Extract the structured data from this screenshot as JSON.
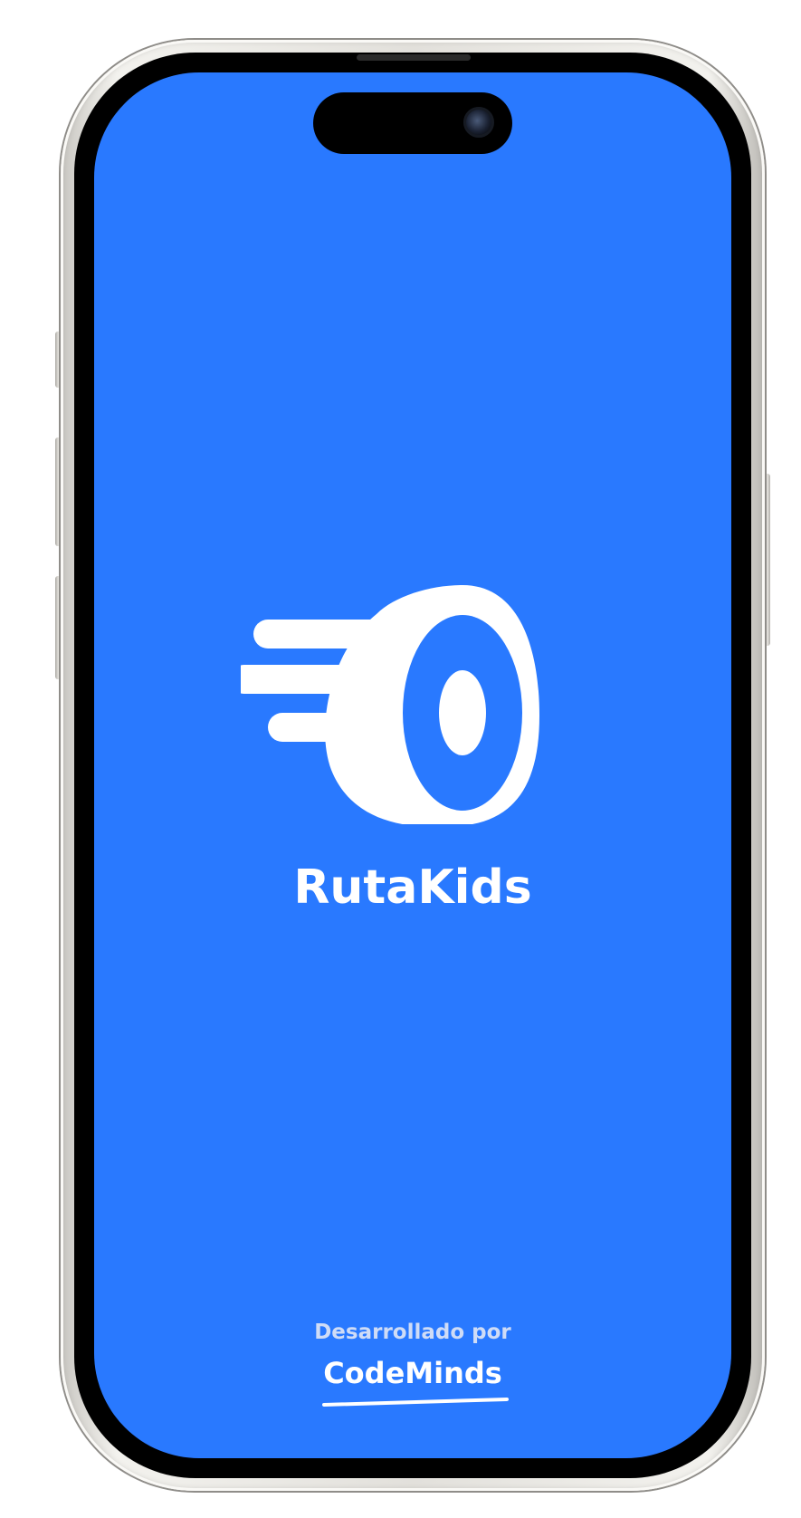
{
  "app": {
    "name": "RutaKids",
    "logo_icon": "speeding-wheel-icon"
  },
  "footer": {
    "credit_label": "Desarrollado por",
    "brand_name": "CodeMinds"
  },
  "colors": {
    "screen_background": "#2979ff",
    "foreground": "#ffffff",
    "credit_text": "#cfdcf6"
  }
}
